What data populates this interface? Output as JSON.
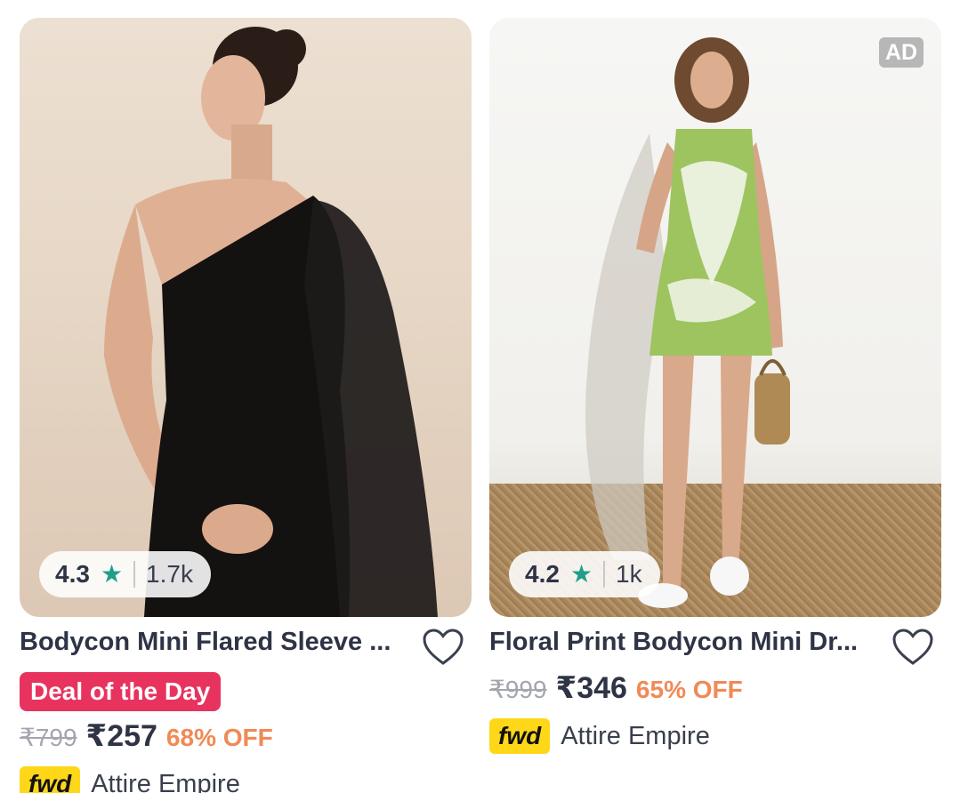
{
  "products": [
    {
      "title": "Bodycon Mini Flared Sleeve ...",
      "rating": "4.3",
      "rating_count": "1.7k",
      "deal_label": "Deal of the Day",
      "mrp": "₹799",
      "price": "₹257",
      "discount": "68% OFF",
      "seller_badge": "fwd",
      "seller": "Attire Empire",
      "image_icon": "product-photo-black-cape-dress"
    },
    {
      "title": "Floral Print Bodycon Mini Dr...",
      "ad_label": "AD",
      "rating": "4.2",
      "rating_count": "1k",
      "mrp": "₹999",
      "price": "₹346",
      "discount": "65% OFF",
      "seller_badge": "fwd",
      "seller": "Attire Empire",
      "image_icon": "product-photo-green-floral-dress"
    }
  ],
  "colors": {
    "star": "#1f9f8a",
    "deal_badge": "#e8335f",
    "discount": "#f08a56",
    "fwd_badge": "#ffd719"
  }
}
